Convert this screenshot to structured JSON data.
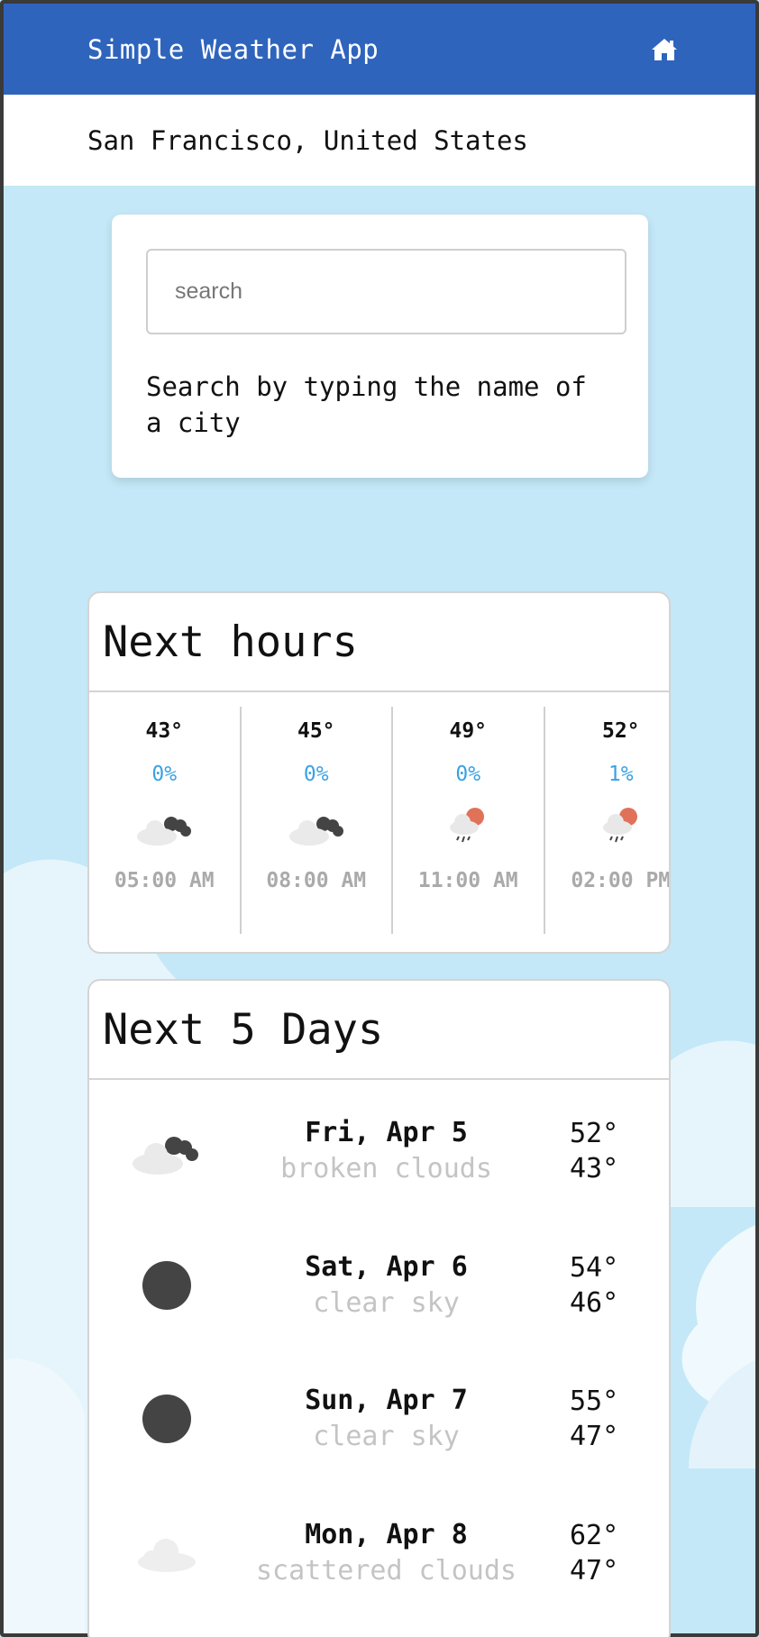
{
  "header": {
    "title": "Simple Weather App",
    "home_icon": "home-icon"
  },
  "location": {
    "text": "San Francisco, United States"
  },
  "search": {
    "placeholder": "search",
    "hint": "Search by typing the name of a city"
  },
  "hours": {
    "title": "Next hours",
    "items": [
      {
        "temp": "43°",
        "pop": "0%",
        "icon": "broken-clouds-icon",
        "time": "05:00 AM"
      },
      {
        "temp": "45°",
        "pop": "0%",
        "icon": "broken-clouds-icon",
        "time": "08:00 AM"
      },
      {
        "temp": "49°",
        "pop": "0%",
        "icon": "light-rain-icon",
        "time": "11:00 AM"
      },
      {
        "temp": "52°",
        "pop": "1%",
        "icon": "light-rain-icon",
        "time": "02:00 PM"
      }
    ]
  },
  "days": {
    "title": "Next 5 Days",
    "items": [
      {
        "date": "Fri, Apr 5",
        "desc": "broken clouds",
        "high": "52°",
        "low": "43°",
        "icon": "broken-clouds-icon"
      },
      {
        "date": "Sat, Apr 6",
        "desc": "clear sky",
        "high": "54°",
        "low": "46°",
        "icon": "clear-sky-icon"
      },
      {
        "date": "Sun, Apr 7",
        "desc": "clear sky",
        "high": "55°",
        "low": "47°",
        "icon": "clear-sky-icon"
      },
      {
        "date": "Mon, Apr 8",
        "desc": "scattered clouds",
        "high": "62°",
        "low": "47°",
        "icon": "scattered-clouds-icon"
      }
    ]
  },
  "colors": {
    "header": "#2f64bd",
    "background": "#c4e8f7",
    "pop": "#3aa2e3",
    "sun": "#e0725a"
  }
}
